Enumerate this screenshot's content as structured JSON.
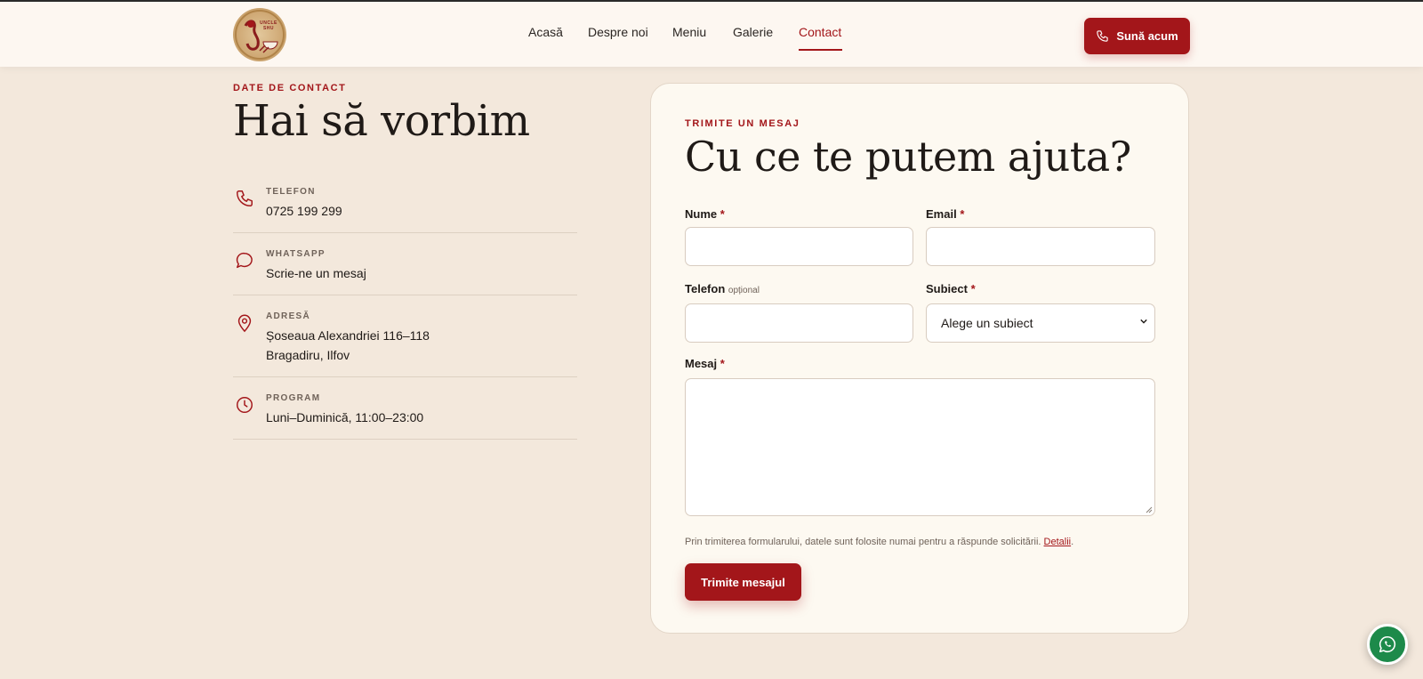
{
  "nav": {
    "items": [
      {
        "label": "Acasă"
      },
      {
        "label": "Despre noi"
      },
      {
        "label": "Meniu"
      },
      {
        "label": "Galerie"
      },
      {
        "label": "Contact",
        "active": true
      }
    ],
    "call_button": "Sună acum"
  },
  "brand": {
    "logo_text": "UNCLE SHU"
  },
  "contact": {
    "eyebrow": "DATE DE CONTACT",
    "title": "Hai să vorbim",
    "items": [
      {
        "icon": "phone-icon",
        "label": "TELEFON",
        "lines": [
          "0725 199 299"
        ]
      },
      {
        "icon": "chat-bubble-icon",
        "label": "WHATSAPP",
        "lines": [
          "Scrie-ne un mesaj"
        ]
      },
      {
        "icon": "map-pin-icon",
        "label": "ADRESĂ",
        "lines": [
          "Șoseaua Alexandriei 116–118",
          "Bragadiru, Ilfov"
        ]
      },
      {
        "icon": "clock-icon",
        "label": "PROGRAM",
        "lines": [
          "Luni–Duminică, 11:00–23:00"
        ]
      }
    ]
  },
  "form": {
    "eyebrow": "TRIMITE UN MESAJ",
    "title": "Cu ce te putem ajuta?",
    "name_label": "Nume",
    "email_label": "Email",
    "phone_label": "Telefon",
    "phone_optional": "opțional",
    "subject_label": "Subiect",
    "subject_value": "Alege un subiect",
    "message_label": "Mesaj",
    "required_mark": "*",
    "privacy_text": "Prin trimiterea formularului, datele sunt folosite numai pentru a răspunde solicitării.",
    "privacy_link": "Detalii",
    "privacy_end": ".",
    "submit_label": "Trimite mesajul"
  },
  "colors": {
    "accent": "#a3161a",
    "background": "#f3e8dc",
    "whatsapp": "#1d8a4a"
  }
}
